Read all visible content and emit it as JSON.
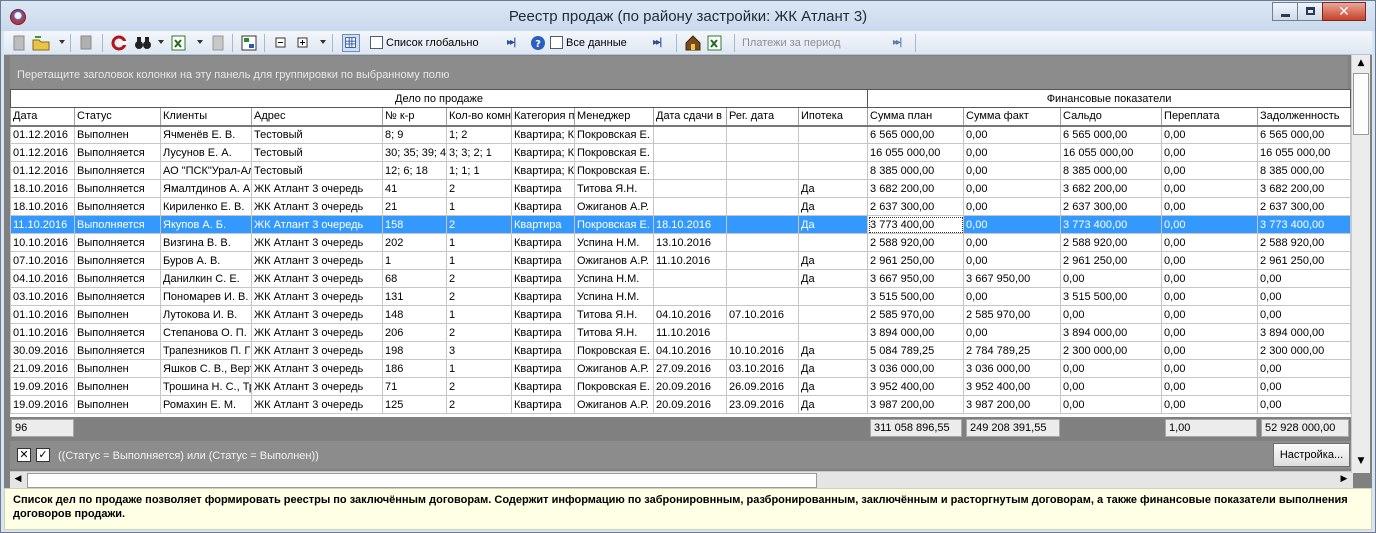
{
  "window": {
    "title": "Реестр продаж (по району застройки: ЖК Атлант 3)"
  },
  "toolbar": {
    "global_list_label": "Список глобально",
    "all_data_label": "Все данные",
    "payments_period_label": "Платежи за период",
    "icons": [
      "new-doc-icon",
      "open-folder-icon",
      "copy-icon",
      "refresh-icon",
      "binoculars-icon",
      "excel-export-icon",
      "print-icon",
      "tree-view-icon",
      "collapse-icon",
      "expand-icon",
      "grid-settings-icon",
      "help-icon",
      "house-icon",
      "excel-icon"
    ]
  },
  "group_panel": {
    "hint": "Перетащите заголовок колонки на эту панель для группировки по выбранному полю"
  },
  "bands": {
    "deal": "Дело по продаже",
    "finance": "Финансовые показатели"
  },
  "columns": [
    "Дата",
    "Статус",
    "Клиенты",
    "Адрес",
    "№ к-р",
    "Кол-во комн",
    "Категория п",
    "Менеджер",
    "Дата сдачи в",
    "Рег. дата",
    "Ипотека",
    "Сумма план",
    "Сумма факт",
    "Сальдо",
    "Переплата",
    "Задолженность"
  ],
  "rows": [
    [
      "01.12.2016",
      "Выполнен",
      "Ячменёв Е. В.",
      "Тестовый",
      "8; 9",
      "1; 2",
      "Квартира; К",
      "Покровская Е.",
      "",
      "",
      "",
      "6 565 000,00",
      "0,00",
      "6 565 000,00",
      "0,00",
      "6 565 000,00"
    ],
    [
      "01.12.2016",
      "Выполняется",
      "Лусунов Е. А.",
      "Тестовый",
      "30; 35; 39; 4",
      "3; 3; 2; 1",
      "Квартира; К",
      "Покровская Е.",
      "",
      "",
      "",
      "16 055 000,00",
      "0,00",
      "16 055 000,00",
      "0,00",
      "16 055 000,00"
    ],
    [
      "01.12.2016",
      "Выполняется",
      "АО \"ПСК\"Урал-Ал",
      "Тестовый",
      "12; 6; 18",
      "1; 1; 1",
      "Квартира; К",
      "Покровская Е.",
      "",
      "",
      "",
      "8 385 000,00",
      "0,00",
      "8 385 000,00",
      "0,00",
      "8 385 000,00"
    ],
    [
      "18.10.2016",
      "Выполняется",
      "Ямалтдинов А. А",
      "ЖК Атлант 3 очередь",
      "41",
      "2",
      "Квартира",
      "Титова Я.Н.",
      "",
      "",
      "Да",
      "3 682 200,00",
      "0,00",
      "3 682 200,00",
      "0,00",
      "3 682 200,00"
    ],
    [
      "18.10.2016",
      "Выполняется",
      "Кириленко Е. В.",
      "ЖК Атлант 3 очередь",
      "21",
      "1",
      "Квартира",
      "Ожиганов А.Р.",
      "",
      "",
      "Да",
      "2 637 300,00",
      "0,00",
      "2 637 300,00",
      "0,00",
      "2 637 300,00"
    ],
    [
      "11.10.2016",
      "Выполняется",
      "Якупов А. Б.",
      "ЖК Атлант 3 очередь",
      "158",
      "2",
      "Квартира",
      "Покровская Е.",
      "18.10.2016",
      "",
      "Да",
      "3 773 400,00",
      "0,00",
      "3 773 400,00",
      "0,00",
      "3 773 400,00"
    ],
    [
      "10.10.2016",
      "Выполняется",
      "Визгина В. В.",
      "ЖК Атлант 3 очередь",
      "202",
      "1",
      "Квартира",
      "Успина Н.М.",
      "13.10.2016",
      "",
      "",
      "2 588 920,00",
      "0,00",
      "2 588 920,00",
      "0,00",
      "2 588 920,00"
    ],
    [
      "07.10.2016",
      "Выполняется",
      "Буров А. В.",
      "ЖК Атлант 3 очередь",
      "1",
      "1",
      "Квартира",
      "Ожиганов А.Р.",
      "11.10.2016",
      "",
      "Да",
      "2 961 250,00",
      "0,00",
      "2 961 250,00",
      "0,00",
      "2 961 250,00"
    ],
    [
      "04.10.2016",
      "Выполняется",
      "Данилкин С. Е.",
      "ЖК Атлант 3 очередь",
      "68",
      "2",
      "Квартира",
      "Успина Н.М.",
      "",
      "",
      "Да",
      "3 667 950,00",
      "3 667 950,00",
      "0,00",
      "0,00",
      "0,00"
    ],
    [
      "03.10.2016",
      "Выполняется",
      "Пономарев И. В.",
      "ЖК Атлант 3 очередь",
      "131",
      "2",
      "Квартира",
      "Успина Н.М.",
      "",
      "",
      "",
      "3 515 500,00",
      "0,00",
      "3 515 500,00",
      "0,00",
      "0,00"
    ],
    [
      "01.10.2016",
      "Выполнен",
      "Лутокова И. В.",
      "ЖК Атлант 3 очередь",
      "148",
      "1",
      "Квартира",
      "Титова Я.Н.",
      "04.10.2016",
      "07.10.2016",
      "",
      "2 585 970,00",
      "2 585 970,00",
      "0,00",
      "0,00",
      "0,00"
    ],
    [
      "01.10.2016",
      "Выполняется",
      "Степанова О. П.",
      "ЖК Атлант 3 очередь",
      "206",
      "2",
      "Квартира",
      "Титова Я.Н.",
      "11.10.2016",
      "",
      "",
      "3 894 000,00",
      "0,00",
      "3 894 000,00",
      "0,00",
      "3 894 000,00"
    ],
    [
      "30.09.2016",
      "Выполняется",
      "Трапезников П. Г",
      "ЖК Атлант 3 очередь",
      "198",
      "3",
      "Квартира",
      "Покровская Е.",
      "04.10.2016",
      "10.10.2016",
      "Да",
      "5 084 789,25",
      "2 784 789,25",
      "2 300 000,00",
      "0,00",
      "2 300 000,00"
    ],
    [
      "21.09.2016",
      "Выполнен",
      "Яшков С. В., Верт",
      "ЖК Атлант 3 очередь",
      "186",
      "1",
      "Квартира",
      "Ожиганов А.Р.",
      "27.09.2016",
      "03.10.2016",
      "Да",
      "3 036 000,00",
      "3 036 000,00",
      "0,00",
      "0,00",
      "0,00"
    ],
    [
      "19.09.2016",
      "Выполнен",
      "Трошина Н. С., Тр",
      "ЖК Атлант 3 очередь",
      "71",
      "2",
      "Квартира",
      "Покровская Е.",
      "20.09.2016",
      "26.09.2016",
      "Да",
      "3 952 400,00",
      "3 952 400,00",
      "0,00",
      "0,00",
      "0,00"
    ],
    [
      "19.09.2016",
      "Выполнен",
      "Ромахин Е. М.",
      "ЖК Атлант 3 очередь",
      "125",
      "2",
      "Квартира",
      "Ожиганов А.Р.",
      "20.09.2016",
      "23.09.2016",
      "Да",
      "3 987 200,00",
      "3 987 200,00",
      "0,00",
      "0,00",
      "0,00"
    ]
  ],
  "selected_row": 5,
  "footer": {
    "count": "96",
    "sum_plan": "311 058 896,55",
    "sum_fact": "249 208 391,55",
    "overpay": "1,00",
    "debt": "52 928 000,00"
  },
  "filter": {
    "text": "((Статус = Выполняется) или (Статус = Выполнен))",
    "settings_label": "Настройка..."
  },
  "description": "Список дел по продаже позволяет формировать реестры по заключённым договорам. Содержит информацию по забронировнным, разбронированным, заключённым и расторгнутым договорам, а также финансовые показатели выполнения договоров продажи.",
  "colors": {
    "selection": "#3399ff",
    "panel_gray": "#808080",
    "description_bg": "#ffffe6"
  }
}
